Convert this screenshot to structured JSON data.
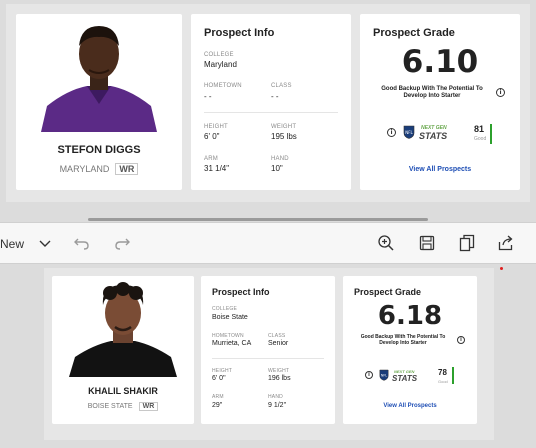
{
  "top": {
    "player": {
      "name": "STEFON DIGGS",
      "school": "MARYLAND",
      "position": "WR"
    },
    "info": {
      "title": "Prospect Info",
      "college_label": "COLLEGE",
      "college": "Maryland",
      "hometown_label": "HOMETOWN",
      "hometown": "- -",
      "class_label": "CLASS",
      "class": "- -",
      "height_label": "HEIGHT",
      "height": "6' 0\"",
      "weight_label": "WEIGHT",
      "weight": "195 lbs",
      "arm_label": "ARM",
      "arm": "31 1/4\"",
      "hand_label": "HAND",
      "hand": "10\""
    },
    "grade": {
      "title": "Prospect Grade",
      "value": "6.10",
      "description": "Good Backup With The Potential To Develop Into Starter",
      "ngs_next": "NEXT GEN",
      "ngs_stats": "STATS",
      "score": "81",
      "score_label": "Good",
      "score_fraction": 0.81,
      "link": "View All Prospects"
    }
  },
  "toolbar": {
    "new_label": "New",
    "icons": [
      "chevron-down-icon",
      "undo-icon",
      "redo-icon",
      "zoom-in-icon",
      "save-icon",
      "copy-icon",
      "share-icon"
    ]
  },
  "bottom": {
    "player": {
      "name": "KHALIL SHAKIR",
      "school": "BOISE STATE",
      "position": "WR"
    },
    "info": {
      "title": "Prospect Info",
      "college_label": "COLLEGE",
      "college": "Boise State",
      "hometown_label": "HOMETOWN",
      "hometown": "Murrieta, CA",
      "class_label": "CLASS",
      "class": "Senior",
      "height_label": "HEIGHT",
      "height": "6' 0\"",
      "weight_label": "WEIGHT",
      "weight": "196 lbs",
      "arm_label": "ARM",
      "arm": "29\"",
      "hand_label": "HAND",
      "hand": "9 1/2\""
    },
    "grade": {
      "title": "Prospect Grade",
      "value": "6.18",
      "description": "Good Backup With The Potential To Develop Into Starter",
      "ngs_next": "NEXT GEN",
      "ngs_stats": "STATS",
      "score": "78",
      "score_label": "Good",
      "score_fraction": 0.78,
      "link": "View All Prospects"
    }
  },
  "colors": {
    "accent_green": "#2ca02c",
    "link_blue": "#1f4fb5",
    "jersey_purple": "#5b2a86"
  }
}
